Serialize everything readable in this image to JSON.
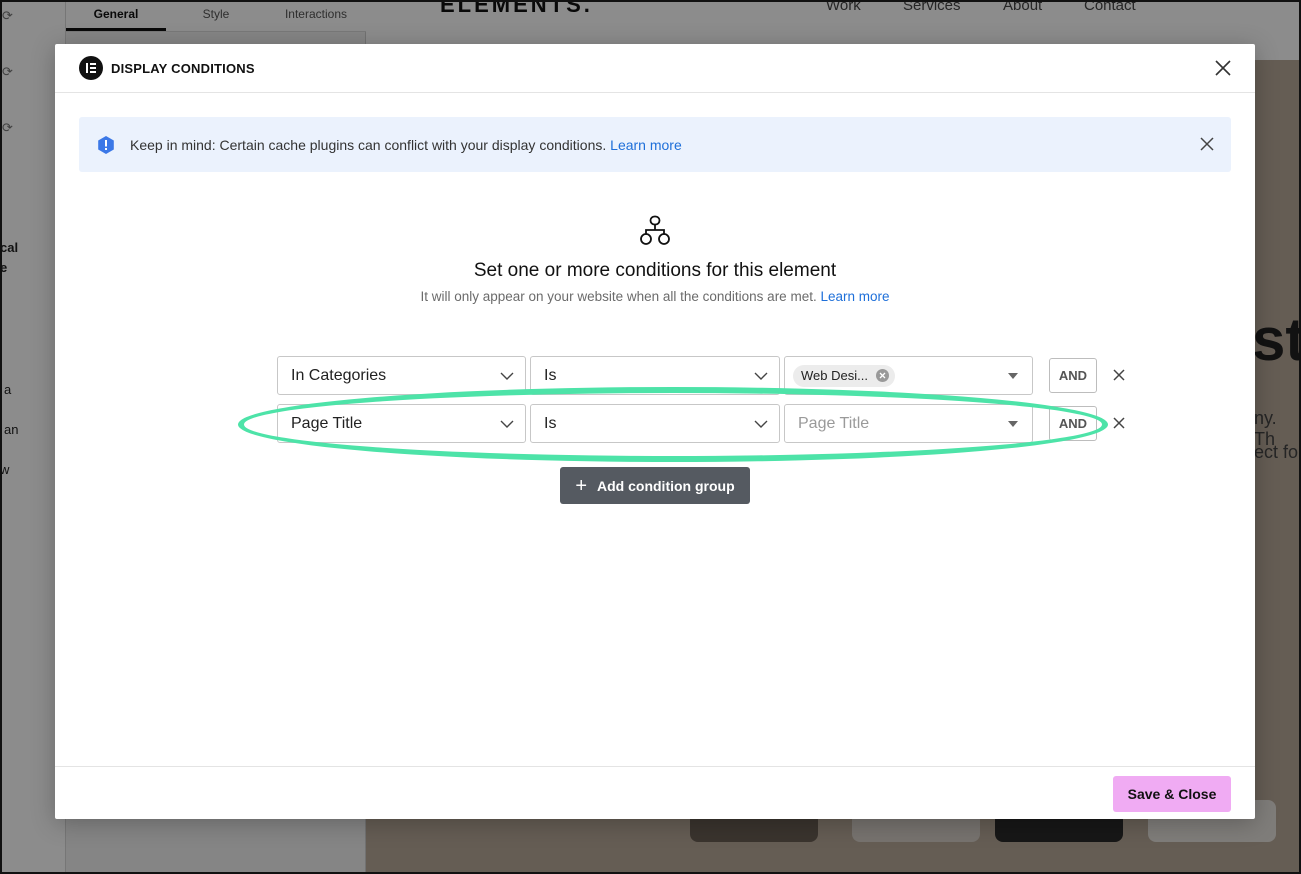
{
  "background": {
    "tabs": [
      "General",
      "Style",
      "Interactions"
    ],
    "sidebar_fragments": [
      "cal",
      "e",
      "a",
      "an",
      "w"
    ],
    "logo": "ELEMENTS.",
    "nav": [
      "Work",
      "Services",
      "About",
      "Contact"
    ],
    "heading_fragment": "st",
    "paragraph_fragments": [
      "ny. Th",
      "ect fo"
    ]
  },
  "modal": {
    "title": "DISPLAY CONDITIONS",
    "notice": {
      "text": "Keep in mind: Certain cache plugins can conflict with your display conditions.",
      "link": "Learn more"
    },
    "heading": "Set one or more conditions for this element",
    "subheading": "It will only appear on your website when all the conditions are met.",
    "subheading_link": "Learn more",
    "conditions": [
      {
        "field": "In Categories",
        "operator": "Is",
        "value_chip": "Web Desi...",
        "connector": "AND"
      },
      {
        "field": "Page Title",
        "operator": "Is",
        "value_placeholder": "Page Title",
        "connector": "AND"
      }
    ],
    "add_group_label": "Add condition group",
    "save_label": "Save & Close"
  },
  "colors": {
    "accent_save": "#f0abf3",
    "highlight": "#4de3a8",
    "notice_bg": "#ebf2fd",
    "link": "#1e6fd9",
    "add_group_bg": "#555a61"
  }
}
